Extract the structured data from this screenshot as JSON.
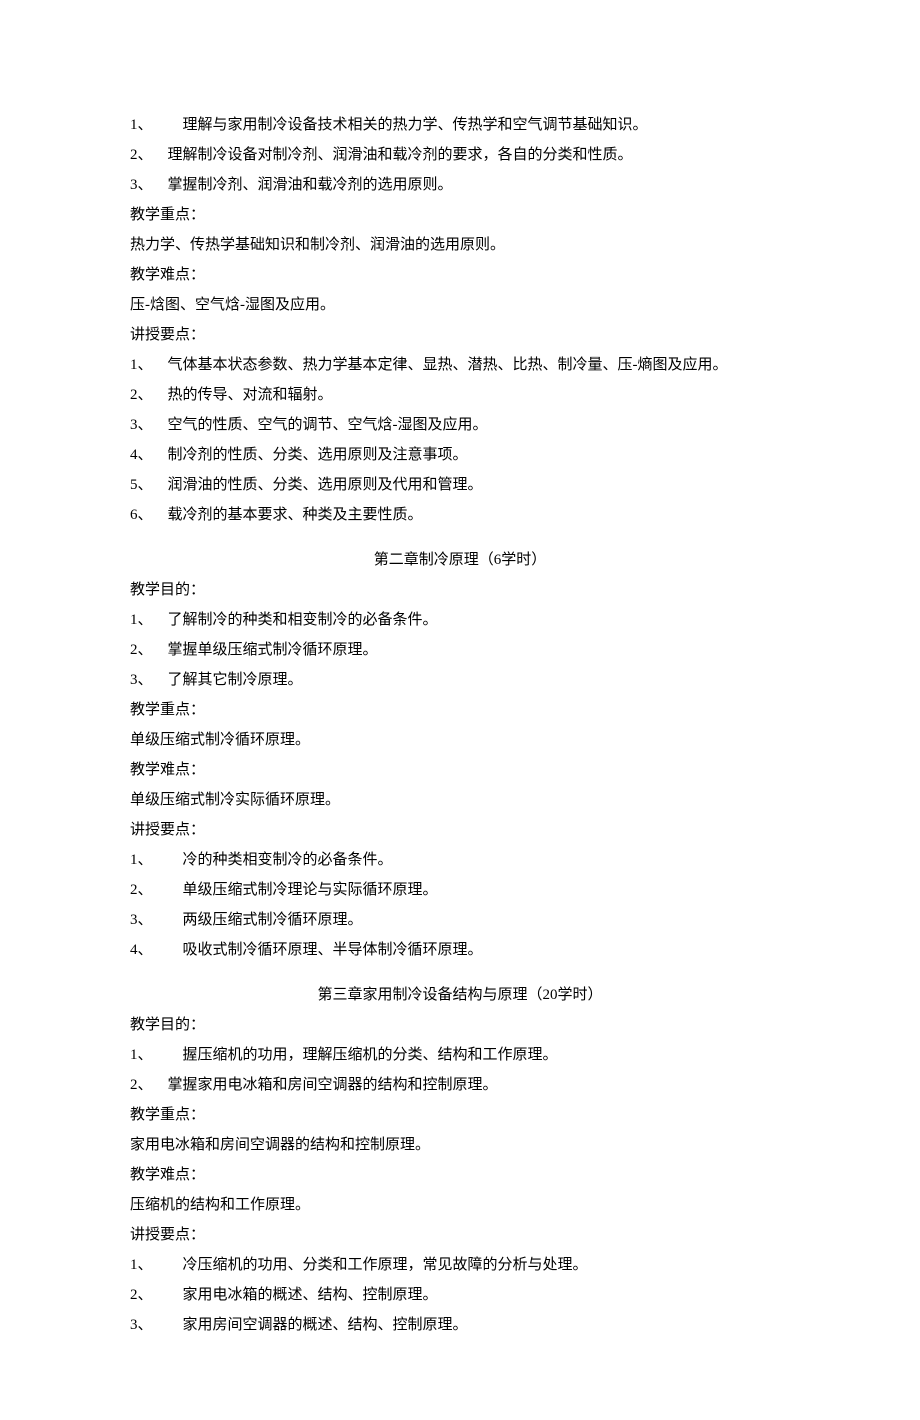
{
  "ch1": {
    "purpose": [
      {
        "num": "1、",
        "wide": true,
        "text": "理解与家用制冷设备技术相关的热力学、传热学和空气调节基础知识。"
      },
      {
        "num": "2、",
        "wide": false,
        "text": "理解制冷设备对制冷剂、润滑油和载冷剂的要求，各自的分类和性质。"
      },
      {
        "num": "3、",
        "wide": false,
        "text": "掌握制冷剂、润滑油和载冷剂的选用原则。"
      }
    ],
    "focus_label": "教学重点：",
    "focus_text": "热力学、传热学基础知识和制冷剂、润滑油的选用原则。",
    "difficulty_label": "教学难点：",
    "difficulty_text": "压-焓图、空气焓-湿图及应用。",
    "points_label": "讲授要点：",
    "points": [
      {
        "num": "1、",
        "text": "气体基本状态参数、热力学基本定律、显热、潜热、比热、制冷量、压-熵图及应用。"
      },
      {
        "num": "2、",
        "text": "热的传导、对流和辐射。"
      },
      {
        "num": "3、",
        "text": "空气的性质、空气的调节、空气焓-湿图及应用。"
      },
      {
        "num": "4、",
        "text": "制冷剂的性质、分类、选用原则及注意事项。"
      },
      {
        "num": "5、",
        "text": "润滑油的性质、分类、选用原则及代用和管理。"
      },
      {
        "num": "6、",
        "text": "载冷剂的基本要求、种类及主要性质。"
      }
    ]
  },
  "ch2": {
    "title": "第二章制冷原理（6学时）",
    "purpose_label": "教学目的：",
    "purpose": [
      {
        "num": "1、",
        "text": "了解制冷的种类和相变制冷的必备条件。"
      },
      {
        "num": "2、",
        "text": "掌握单级压缩式制冷循环原理。"
      },
      {
        "num": "3、",
        "text": "了解其它制冷原理。"
      }
    ],
    "focus_label": "教学重点：",
    "focus_text": "单级压缩式制冷循环原理。",
    "difficulty_label": "教学难点：",
    "difficulty_text": "单级压缩式制冷实际循环原理。",
    "points_label": "讲授要点：",
    "points": [
      {
        "num": "1、",
        "text": "冷的种类相变制冷的必备条件。"
      },
      {
        "num": "2、",
        "text": "单级压缩式制冷理论与实际循环原理。"
      },
      {
        "num": "3、",
        "text": "两级压缩式制冷循环原理。"
      },
      {
        "num": "4、",
        "text": "吸收式制冷循环原理、半导体制冷循环原理。"
      }
    ]
  },
  "ch3": {
    "title": "第三章家用制冷设备结构与原理（20学时）",
    "purpose_label": "教学目的：",
    "purpose": [
      {
        "num": "1、",
        "wide": true,
        "text": "握压缩机的功用，理解压缩机的分类、结构和工作原理。"
      },
      {
        "num": "2、",
        "wide": false,
        "text": "掌握家用电冰箱和房间空调器的结构和控制原理。"
      }
    ],
    "focus_label": "教学重点：",
    "focus_text": "家用电冰箱和房间空调器的结构和控制原理。",
    "difficulty_label": "教学难点：",
    "difficulty_text": "压缩机的结构和工作原理。",
    "points_label": "讲授要点：",
    "points": [
      {
        "num": "1、",
        "text": "冷压缩机的功用、分类和工作原理，常见故障的分析与处理。"
      },
      {
        "num": "2、",
        "text": "家用电冰箱的概述、结构、控制原理。"
      },
      {
        "num": "3、",
        "text": "家用房间空调器的概述、结构、控制原理。"
      }
    ]
  }
}
